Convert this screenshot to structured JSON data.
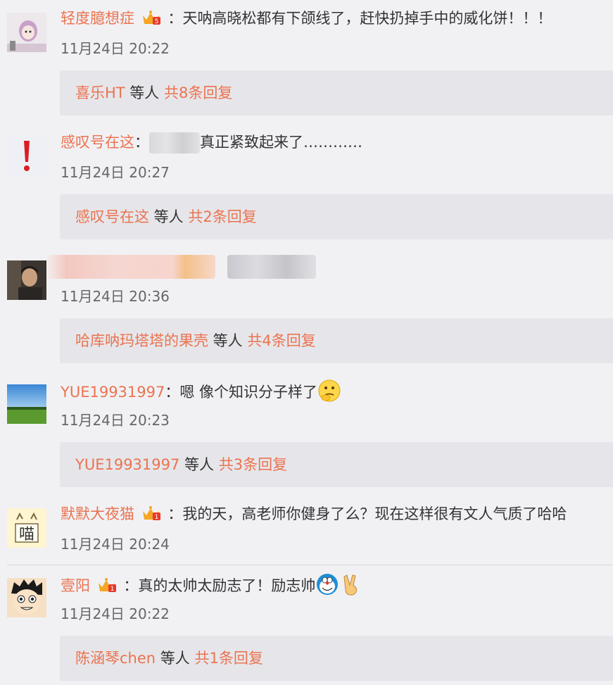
{
  "comments": [
    {
      "user": "轻度臆想症",
      "colon": "：",
      "text": "天呐高晓松都有下颌线了，赶快扔掉手中的威化饼！！！",
      "time": "11月24日 20:22",
      "reply_user": "喜乐HT",
      "reply_mid": " 等人 ",
      "reply_count": "共8条回复"
    },
    {
      "user": "感叹号在这",
      "colon": "：",
      "text": "真正紧致起来了…………",
      "time": "11月24日 20:27",
      "reply_user": "感叹号在这",
      "reply_mid": " 等人 ",
      "reply_count": "共2条回复"
    },
    {
      "time": "11月24日 20:36",
      "reply_user": "哈库呐玛塔塔的果壳",
      "reply_mid": " 等人 ",
      "reply_count": "共4条回复"
    },
    {
      "user": "YUE19931997",
      "colon": "：",
      "text": "嗯 像个知识分子样了",
      "time": "11月24日 20:23",
      "reply_user": "YUE19931997",
      "reply_mid": " 等人 ",
      "reply_count": "共3条回复"
    },
    {
      "user": "默默大夜猫",
      "colon": "：",
      "text": "我的天，高老师你健身了么？现在这样很有文人气质了哈哈",
      "time": "11月24日 20:24"
    },
    {
      "user": "壹阳",
      "colon": "：",
      "text": "真的太帅太励志了！励志帅",
      "time": "11月24日 20:22",
      "reply_user": "陈涵琴chen",
      "reply_mid": " 等人 ",
      "reply_count": "共1条回复"
    }
  ],
  "avatar_5_text": "喵",
  "colors": {
    "accent": "#eb7350",
    "bg": "#f1f1f4",
    "reply_bg": "#e6e6ea"
  }
}
